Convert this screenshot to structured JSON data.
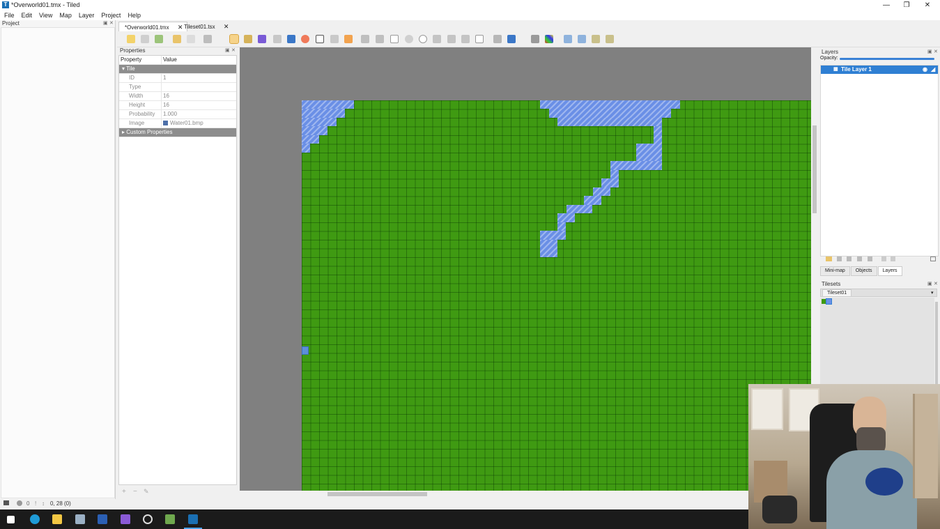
{
  "window": {
    "title": "*Overworld01.tmx - Tiled",
    "app_icon": "T"
  },
  "window_controls": {
    "minimize": "—",
    "maximize": "❐",
    "close": "✕"
  },
  "menu": [
    "File",
    "Edit",
    "View",
    "Map",
    "Layer",
    "Project",
    "Help"
  ],
  "project_panel": {
    "title": "Project"
  },
  "tabs": [
    {
      "label": "*Overworld01.tmx",
      "close": "✕"
    },
    {
      "label": "Tileset01.tsx",
      "close": "✕"
    }
  ],
  "properties": {
    "title": "Properties",
    "header": {
      "property": "Property",
      "value": "Value"
    },
    "group_tile": "Tile",
    "rows": [
      {
        "key": "ID",
        "value": "1"
      },
      {
        "key": "Type",
        "value": ""
      },
      {
        "key": "Width",
        "value": "16"
      },
      {
        "key": "Height",
        "value": "16"
      },
      {
        "key": "Probability",
        "value": "1.000"
      },
      {
        "key": "Image",
        "value": "Water01.bmp"
      }
    ],
    "group_custom": "Custom Properties",
    "footer_add": "+",
    "footer_remove": "−",
    "footer_edit": "✎"
  },
  "layers_panel": {
    "title": "Layers",
    "opacity_label": "Opacity:",
    "opacity": 1.0,
    "layers": [
      {
        "name": "Tile Layer 1",
        "visible_icon": "eye-icon"
      }
    ],
    "bottom_tabs": [
      "Mini-map",
      "Objects",
      "Layers"
    ]
  },
  "tilesets_panel": {
    "title": "Tilesets",
    "selected_tab": "Tileset01"
  },
  "status": {
    "coords": "0, 28 (0)",
    "layer_value": "0"
  },
  "colors": {
    "grass": "#3f9a12",
    "water": "#6a8fe6",
    "selection": "#2f7fd3",
    "canvas_bg": "#808080"
  }
}
